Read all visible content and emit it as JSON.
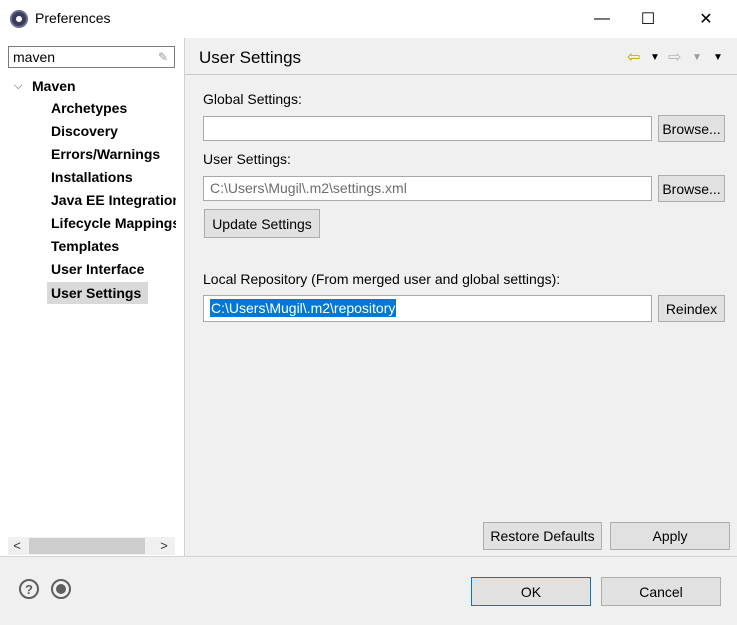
{
  "window": {
    "title": "Preferences",
    "minimize_glyph": "—",
    "maximize_glyph": "☐",
    "close_glyph": "✕"
  },
  "sidebar": {
    "filter_value": "maven",
    "root_label": "Maven",
    "items": [
      {
        "label": "Archetypes"
      },
      {
        "label": "Discovery"
      },
      {
        "label": "Errors/Warnings"
      },
      {
        "label": "Installations"
      },
      {
        "label": "Java EE Integration"
      },
      {
        "label": "Lifecycle Mappings"
      },
      {
        "label": "Templates"
      },
      {
        "label": "User Interface"
      },
      {
        "label": "User Settings"
      }
    ],
    "selected_index": 8
  },
  "page": {
    "title": "User Settings",
    "global_settings": {
      "label": "Global Settings:",
      "value": "",
      "browse_label": "Browse..."
    },
    "user_settings": {
      "label": "User Settings:",
      "value": "C:\\Users\\Mugil\\.m2\\settings.xml",
      "browse_label": "Browse..."
    },
    "update_label": "Update Settings",
    "local_repo": {
      "label": "Local Repository (From merged user and global settings):",
      "value": "C:\\Users\\Mugil\\.m2\\repository",
      "reindex_label": "Reindex"
    },
    "restore_defaults_label": "Restore Defaults",
    "apply_label": "Apply"
  },
  "footer": {
    "ok_label": "OK",
    "cancel_label": "Cancel"
  },
  "icons": {
    "back": "back-arrow-icon",
    "forward": "forward-arrow-icon",
    "help": "help-icon",
    "record": "record-icon"
  },
  "colors": {
    "selection_bg": "#0078d7",
    "nav_back_arrow": "#c8a000"
  }
}
